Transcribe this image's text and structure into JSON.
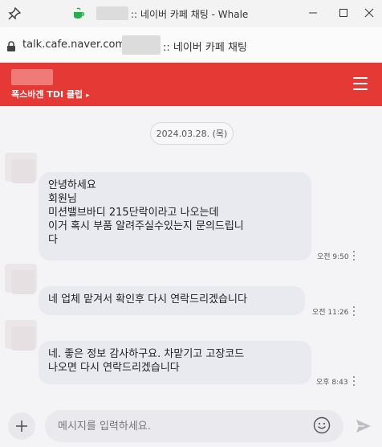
{
  "window": {
    "title": ":: 네이버 카페 채팅 - Whale"
  },
  "address": {
    "host": "talk.cafe.naver.com",
    "rest": ":: 네이버 카페 채팅"
  },
  "header": {
    "cafe_name": "폭스바겐 TDI 클럽",
    "brand_color": "#e53935"
  },
  "chat": {
    "date": "2024.03.28. (목)",
    "messages": [
      {
        "lines": [
          "안녕하세요",
          "회원님",
          "미션밸브바디 215단락이라고 나오는데",
          "이거 혹시 부품 알려주실수있는지 문의드립니",
          "다"
        ],
        "time": "오전 9:50"
      },
      {
        "lines": [
          "네 업체 맡겨서 확인후 다시 연락드리겠습니다"
        ],
        "time": "오전 11:26"
      },
      {
        "lines": [
          "네. 좋은 정보 감사하구요. 차맡기고 고장코드",
          "나오면 다시 연락드리겠습니다"
        ],
        "time": "오후 8:43"
      }
    ]
  },
  "composer": {
    "placeholder": "메시지를 입력하세요."
  },
  "icons": {
    "pin": "pin-icon",
    "app": "whale-cup-icon",
    "minimize": "minimize-icon",
    "maximize": "maximize-icon",
    "close": "close-icon",
    "lock": "lock-icon",
    "menu": "hamburger-menu-icon",
    "plus": "plus-icon",
    "emoji": "emoji-icon",
    "send": "send-icon"
  }
}
